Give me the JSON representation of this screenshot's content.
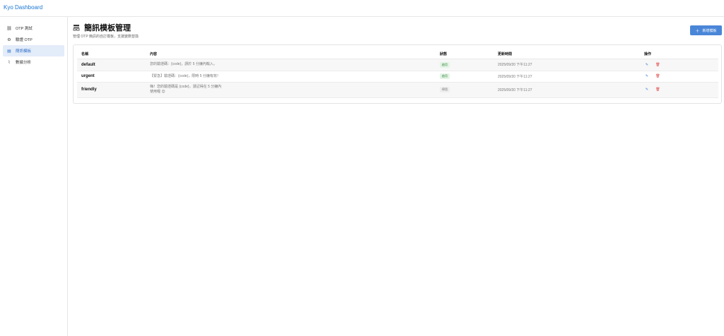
{
  "app": {
    "brand": "Kyo Dashboard"
  },
  "sidebar": {
    "items": [
      {
        "label": "OTP 測試",
        "icon": "link-icon"
      },
      {
        "label": "驗證 OTP",
        "icon": "gear-icon"
      },
      {
        "label": "簡訊模板",
        "icon": "template-icon",
        "active": true
      },
      {
        "label": "數據分析",
        "icon": "chart-icon"
      }
    ]
  },
  "header": {
    "title": "簡訊模板管理",
    "subtitle": "管理 OTP 簡訊的自訂模板，支援變數替換",
    "add_button": "新增模板"
  },
  "table": {
    "columns": [
      "名稱",
      "內容",
      "狀態",
      "更新時間",
      "操作"
    ],
    "rows": [
      {
        "name": "default",
        "content": "您的驗證碼：{code}，請於 5 分鐘內輸入。",
        "status": "啟用",
        "status_active": true,
        "updated": "2025/09/20 下午11:27"
      },
      {
        "name": "urgent",
        "content": "【緊急】驗證碼：{code}，限時 5 分鐘有效！",
        "status": "啟用",
        "status_active": true,
        "updated": "2025/09/20 下午11:27"
      },
      {
        "name": "friendly",
        "content_line1": "嗨！您的驗證碼是 {code}，請記得在 5 分鐘內",
        "content_line2": "使用喔 😊",
        "status": "停用",
        "status_active": false,
        "updated": "2025/09/20 下午11:27"
      }
    ]
  },
  "colors": {
    "accent": "#4a86d8",
    "active_nav_bg": "#e3ecf9",
    "delete": "#e04848",
    "badge_on": "#3a8a45"
  }
}
